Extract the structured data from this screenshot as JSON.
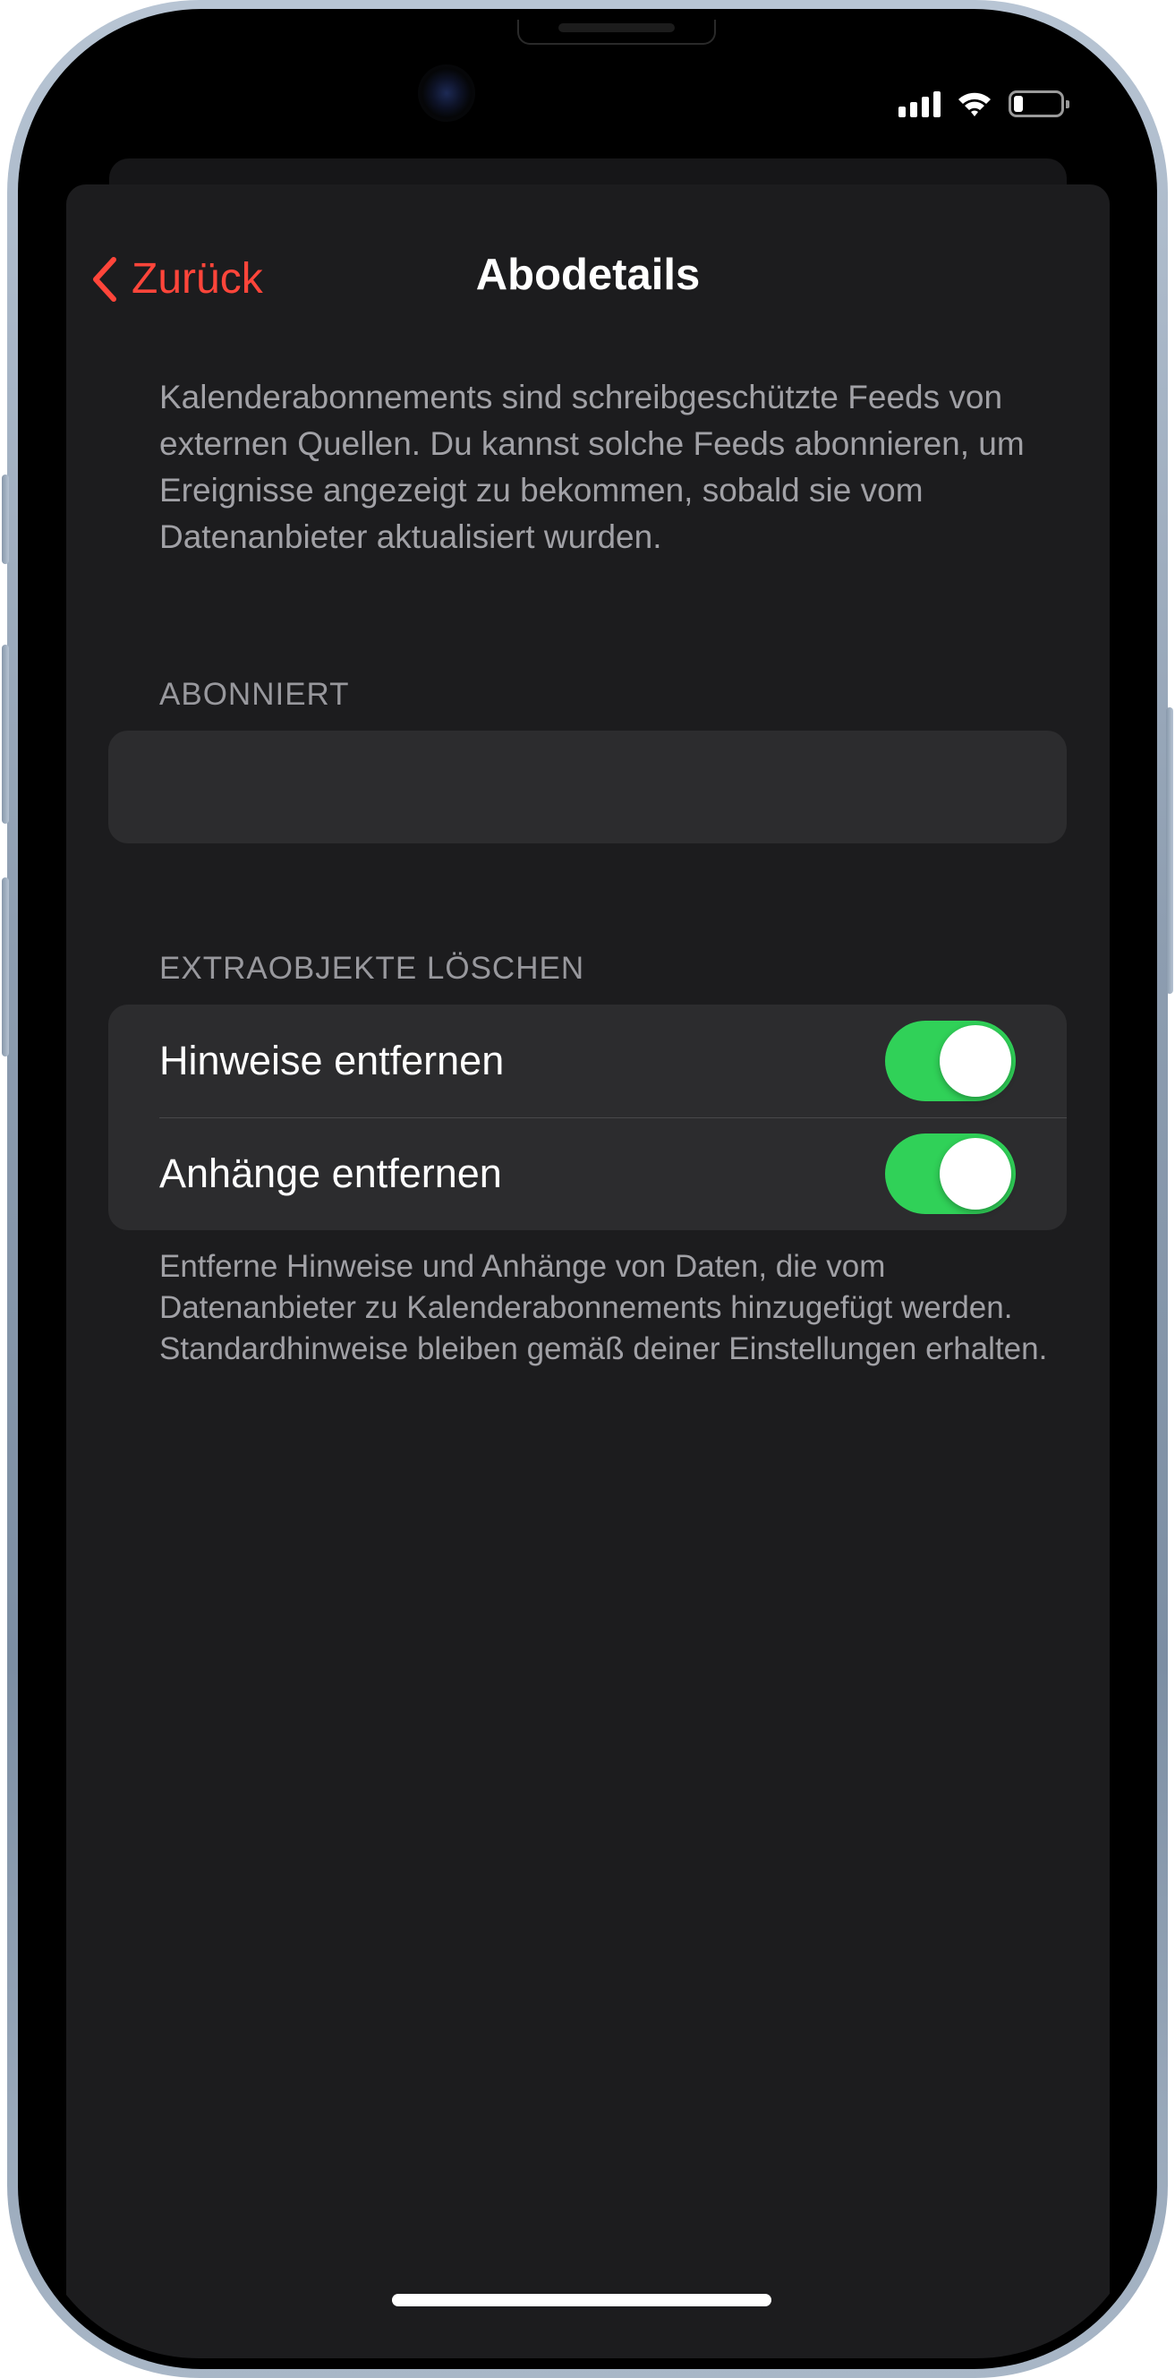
{
  "status_bar": {
    "signal_icon": "cellular-signal-icon",
    "wifi_icon": "wifi-icon",
    "battery_icon": "battery-icon",
    "battery_level": 0.15
  },
  "nav": {
    "back_label": "Zurück",
    "back_icon": "chevron-left-icon",
    "title": "Abodetails"
  },
  "intro_text": "Kalenderabonnements sind schreibgeschützte Feeds von externen Quellen. Du kannst solche Feeds abonnieren, um Ereignisse angezeigt zu bekommen, sobald sie vom Datenanbieter aktualisiert wurden.",
  "subscribed": {
    "header": "ABONNIERT",
    "items": []
  },
  "remove_extras": {
    "header": "EXTRAOBJEKTE LÖSCHEN",
    "rows": [
      {
        "label": "Hinweise entfernen",
        "enabled": true
      },
      {
        "label": "Anhänge entfernen",
        "enabled": true
      }
    ],
    "footer": "Entferne Hinweise und Anhänge von Daten, die vom Datenanbieter zu Kalenderabonnements hinzugefügt werden. Standardhinweise bleiben gemäß deiner Einstellungen erhalten."
  },
  "colors": {
    "accent": "#ff453a",
    "toggle_on": "#30d158",
    "background": "#1c1c1e",
    "cell_background": "#2c2c2e"
  }
}
